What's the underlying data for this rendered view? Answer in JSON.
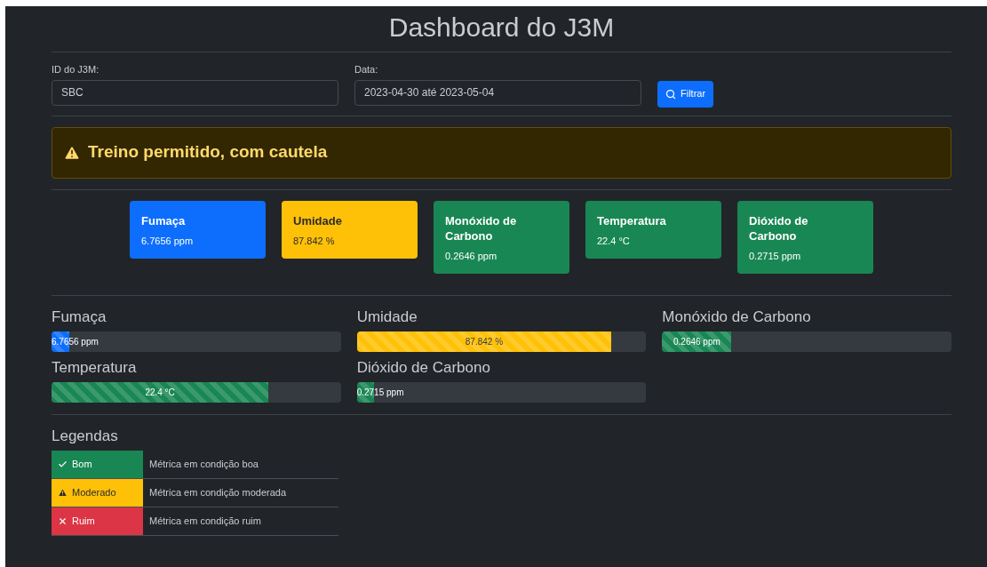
{
  "title": "Dashboard do J3M",
  "filters": {
    "id_label": "ID do J3M:",
    "id_value": "SBC",
    "date_label": "Data:",
    "date_value": "2023-04-30 até 2023-05-04",
    "button": "Filtrar"
  },
  "alert": {
    "text": "Treino permitido, com cautela"
  },
  "cards": [
    {
      "title": "Fumaça",
      "value": "6.7656 ppm",
      "color": "#0d6efd"
    },
    {
      "title": "Umidade",
      "value": "87.842 %",
      "color": "#ffc107"
    },
    {
      "title": "Monóxido de Carbono",
      "value": "0.2646 ppm",
      "color": "#198754"
    },
    {
      "title": "Temperatura",
      "value": "22.4 °C",
      "color": "#198754"
    },
    {
      "title": "Dióxido de Carbono",
      "value": "0.2715 ppm",
      "color": "#198754"
    }
  ],
  "bars": [
    {
      "name": "Fumaça",
      "reading": "6.7656 ppm",
      "level": 0.06,
      "color": "#0d6efd"
    },
    {
      "name": "Umidade",
      "reading": "87.842 %",
      "level": 0.88,
      "color": "#ffc107"
    },
    {
      "name": "Monóxido de Carbono",
      "reading": "0.2646 ppm",
      "level": 0.24,
      "color": "#198754"
    },
    {
      "name": "Temperatura",
      "reading": "22.4 °C",
      "level": 0.75,
      "color": "#198754"
    },
    {
      "name": "Dióxido de Carbono",
      "reading": "0.2715 ppm",
      "level": 0.06,
      "color": "#198754"
    }
  ],
  "legend": {
    "title": "Legendas",
    "items": [
      {
        "kind": "check",
        "label": "Bom",
        "description": "Métrica em condição boa",
        "color": "#198754"
      },
      {
        "kind": "warning",
        "label": "Moderado",
        "description": "Métrica em condição moderada",
        "color": "#ffc107"
      },
      {
        "kind": "cross",
        "label": "Ruim",
        "description": "Métrica em condição ruim",
        "color": "#dc3545"
      }
    ]
  }
}
